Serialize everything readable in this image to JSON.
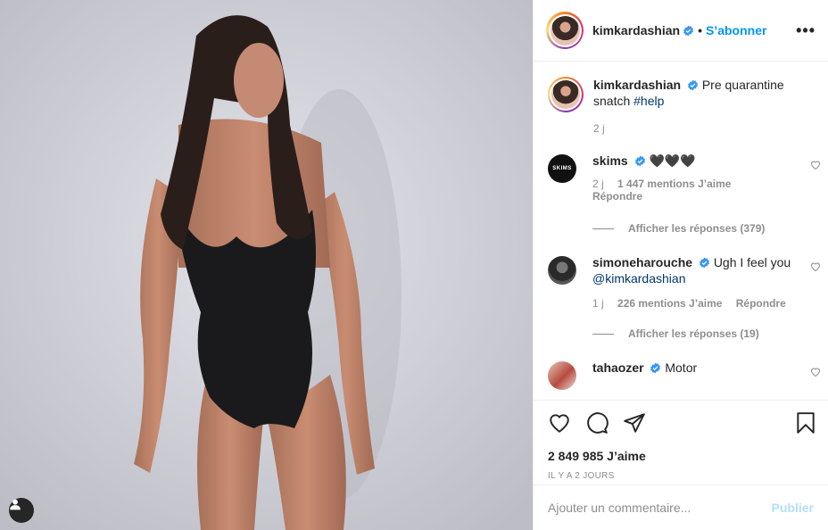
{
  "post": {
    "username": "kimkardashian",
    "follow_label": "S’abonner",
    "more_label": "•••",
    "dot": "•",
    "caption_text": "Pre quarantine snatch",
    "caption_hashtag": "#help",
    "caption_time": "2 j"
  },
  "comments": [
    {
      "username": "skims",
      "avatar_text": "SKIMS",
      "text": "🖤🖤🖤",
      "time": "2 j",
      "likes": "1 447 mentions J’aime",
      "reply_label": "Répondre",
      "view_replies": "Afficher les réponses (379)"
    },
    {
      "username": "simoneharouche",
      "text": "Ugh I feel you",
      "mention": "@kimkardashian",
      "time": "1 j",
      "likes": "226 mentions J’aime",
      "reply_label": "Répondre",
      "view_replies": "Afficher les réponses (19)"
    },
    {
      "username": "tahaozer",
      "text": "Motor"
    }
  ],
  "actions": {
    "likes_count": "2 849 985 J’aime",
    "date": "IL Y A 2 JOURS"
  },
  "composer": {
    "placeholder": "Ajouter un commentaire...",
    "publish_label": "Publier"
  },
  "colors": {
    "accent_blue": "#0095f6",
    "publish_disabled": "#b2dffc",
    "verified_blue": "#3897f0",
    "muted_text": "#8e8e8e"
  },
  "icons": [
    "verified-icon",
    "more-icon",
    "heart-icon",
    "comment-icon",
    "share-icon",
    "bookmark-icon",
    "user-tag-icon"
  ]
}
